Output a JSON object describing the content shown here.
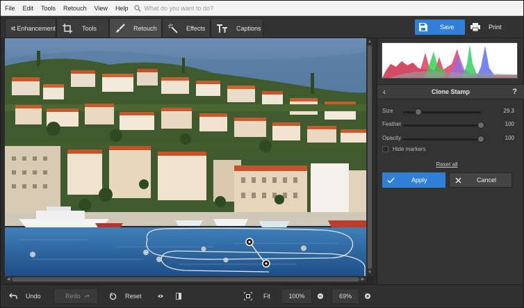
{
  "menu": {
    "items": [
      "File",
      "Edit",
      "Tools",
      "Retouch",
      "View",
      "Help"
    ],
    "search_placeholder": "What do you want to do?"
  },
  "tabs": [
    {
      "label": "Enhancement",
      "icon": "sliders-icon"
    },
    {
      "label": "Tools",
      "icon": "crop-icon"
    },
    {
      "label": "Retouch",
      "icon": "brush-icon",
      "active": true
    },
    {
      "label": "Effects",
      "icon": "magic-wand-icon"
    },
    {
      "label": "Captions",
      "icon": "text-icon"
    }
  ],
  "toolbar": {
    "save_label": "Save",
    "print_label": "Print"
  },
  "panel": {
    "title": "Clone Stamp",
    "help": "?",
    "sliders": [
      {
        "label": "Size",
        "value": "29.3",
        "fraction": 0.2
      },
      {
        "label": "Feather",
        "value": "100",
        "fraction": 1.0
      },
      {
        "label": "Opacity",
        "value": "100",
        "fraction": 1.0
      }
    ],
    "hide_markers_label": "Hide markers",
    "reset_all_label": "Reset all",
    "apply_label": "Apply",
    "cancel_label": "Cancel"
  },
  "bottom": {
    "undo_label": "Undo",
    "redo_label": "Redo",
    "reset_label": "Reset",
    "fit_label": "Fit",
    "zoom_100_label": "100%",
    "zoom_value": "69%"
  },
  "colors": {
    "accent": "#2f80d6",
    "background": "#2b2b2b",
    "panel": "#333333"
  }
}
